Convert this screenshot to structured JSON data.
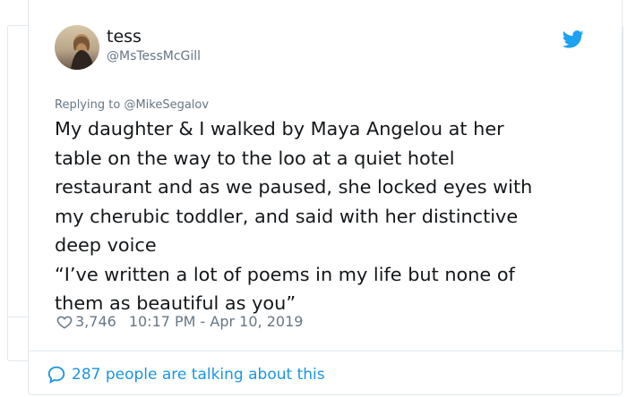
{
  "tweet": {
    "display_name": "tess",
    "handle": "@MsTessMcGill",
    "reply_prefix": "Replying to",
    "reply_to": "@MikeSegalov",
    "body_lines": [
      "My daughter & I walked by Maya Angelou at her",
      "table on the way to the loo at a quiet hotel",
      "restaurant and as we paused, she locked eyes with",
      "my cherubic toddler, and said with her distinctive",
      "deep voice",
      "“I’ve written a lot of poems in my life but none of",
      "them as beautiful as you”"
    ],
    "likes": "3,746",
    "timestamp": "10:17 PM - Apr 10, 2019",
    "talking": "287 people are talking about this"
  },
  "colors": {
    "twitter_blue": "#1da1f2",
    "link_blue": "#1b95e0",
    "muted": "#657786",
    "border": "#e1e8ed"
  },
  "icons": {
    "brand": "twitter-bird-icon",
    "like": "heart-icon",
    "reply": "speech-bubble-icon"
  },
  "background_fragment": "n"
}
